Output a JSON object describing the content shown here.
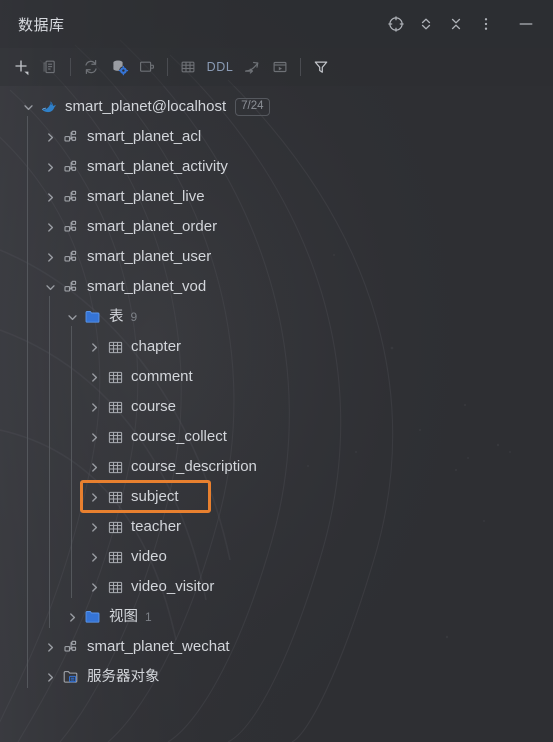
{
  "window": {
    "title": "数据库",
    "accent_orange": "#e8802f",
    "background": "#2e2f33",
    "text_color": "#d3d6db"
  },
  "titlebar": {
    "actions": [
      {
        "name": "locate-icon",
        "label": "定位"
      },
      {
        "name": "expand-all-icon",
        "label": "全部展开"
      },
      {
        "name": "collapse-all-icon",
        "label": "全部折叠"
      },
      {
        "name": "more-options-icon",
        "label": "更多选项"
      },
      {
        "name": "minimize-icon",
        "label": "最小化"
      }
    ]
  },
  "toolbar": {
    "items": [
      {
        "name": "add-button",
        "icon": "plus-dropdown",
        "label": "新建",
        "enabled": true
      },
      {
        "name": "duplicate-button",
        "icon": "copy",
        "label": "复制",
        "enabled": false
      },
      {
        "name": "divider-1",
        "icon": "divider",
        "label": ""
      },
      {
        "name": "refresh-button",
        "icon": "refresh",
        "label": "刷新",
        "enabled": false
      },
      {
        "name": "data-source-properties-button",
        "icon": "database-gear",
        "label": "数据源属性",
        "enabled": true
      },
      {
        "name": "jump-to-console-button",
        "icon": "console",
        "label": "跳转到控制台",
        "enabled": false
      },
      {
        "name": "divider-2",
        "icon": "divider",
        "label": ""
      },
      {
        "name": "open-table-editor-button",
        "icon": "table",
        "label": "数据编辑器",
        "enabled": false
      },
      {
        "name": "ddl-button",
        "icon": "text",
        "label": "DDL",
        "enabled": true
      },
      {
        "name": "jump-to-source-button",
        "icon": "jump-to-source",
        "label": "跳转到源",
        "enabled": false
      },
      {
        "name": "modify-button",
        "icon": "modify-window",
        "label": "修改",
        "enabled": false
      },
      {
        "name": "divider-3",
        "icon": "divider",
        "label": ""
      },
      {
        "name": "filter-button",
        "icon": "filter",
        "label": "筛选",
        "enabled": true
      }
    ],
    "ddl_label": "DDL"
  },
  "tree": {
    "nodes": [
      {
        "id": "ds",
        "label": "smart_planet@localhost",
        "icon": "mysql-dolphin-icon",
        "depth": 0,
        "state": "expanded",
        "badge": "7/24"
      },
      {
        "id": "s1",
        "label": "smart_planet_acl",
        "icon": "schema-icon",
        "depth": 1,
        "state": "collapsed"
      },
      {
        "id": "s2",
        "label": "smart_planet_activity",
        "icon": "schema-icon",
        "depth": 1,
        "state": "collapsed"
      },
      {
        "id": "s3",
        "label": "smart_planet_live",
        "icon": "schema-icon",
        "depth": 1,
        "state": "collapsed"
      },
      {
        "id": "s4",
        "label": "smart_planet_order",
        "icon": "schema-icon",
        "depth": 1,
        "state": "collapsed"
      },
      {
        "id": "s5",
        "label": "smart_planet_user",
        "icon": "schema-icon",
        "depth": 1,
        "state": "collapsed"
      },
      {
        "id": "s6",
        "label": "smart_planet_vod",
        "icon": "schema-icon",
        "depth": 1,
        "state": "expanded"
      },
      {
        "id": "g1",
        "label": "表",
        "icon": "folder-icon",
        "depth": 2,
        "state": "expanded",
        "count": "9"
      },
      {
        "id": "t1",
        "label": "chapter",
        "icon": "table-icon",
        "depth": 3,
        "state": "collapsed"
      },
      {
        "id": "t2",
        "label": "comment",
        "icon": "table-icon",
        "depth": 3,
        "state": "collapsed"
      },
      {
        "id": "t3",
        "label": "course",
        "icon": "table-icon",
        "depth": 3,
        "state": "collapsed"
      },
      {
        "id": "t4",
        "label": "course_collect",
        "icon": "table-icon",
        "depth": 3,
        "state": "collapsed"
      },
      {
        "id": "t5",
        "label": "course_description",
        "icon": "table-icon",
        "depth": 3,
        "state": "collapsed"
      },
      {
        "id": "t6",
        "label": "subject",
        "icon": "table-icon",
        "depth": 3,
        "state": "collapsed",
        "highlighted": true
      },
      {
        "id": "t7",
        "label": "teacher",
        "icon": "table-icon",
        "depth": 3,
        "state": "collapsed"
      },
      {
        "id": "t8",
        "label": "video",
        "icon": "table-icon",
        "depth": 3,
        "state": "collapsed"
      },
      {
        "id": "t9",
        "label": "video_visitor",
        "icon": "table-icon",
        "depth": 3,
        "state": "collapsed"
      },
      {
        "id": "g2",
        "label": "视图",
        "icon": "folder-icon",
        "depth": 2,
        "state": "collapsed",
        "count": "1"
      },
      {
        "id": "s7",
        "label": "smart_planet_wechat",
        "icon": "schema-icon",
        "depth": 1,
        "state": "collapsed"
      },
      {
        "id": "so",
        "label": "服务器对象",
        "icon": "server-objects-icon",
        "depth": 1,
        "state": "collapsed"
      }
    ]
  },
  "highlight": {
    "target_id": "t6",
    "color": "#e8802f"
  }
}
